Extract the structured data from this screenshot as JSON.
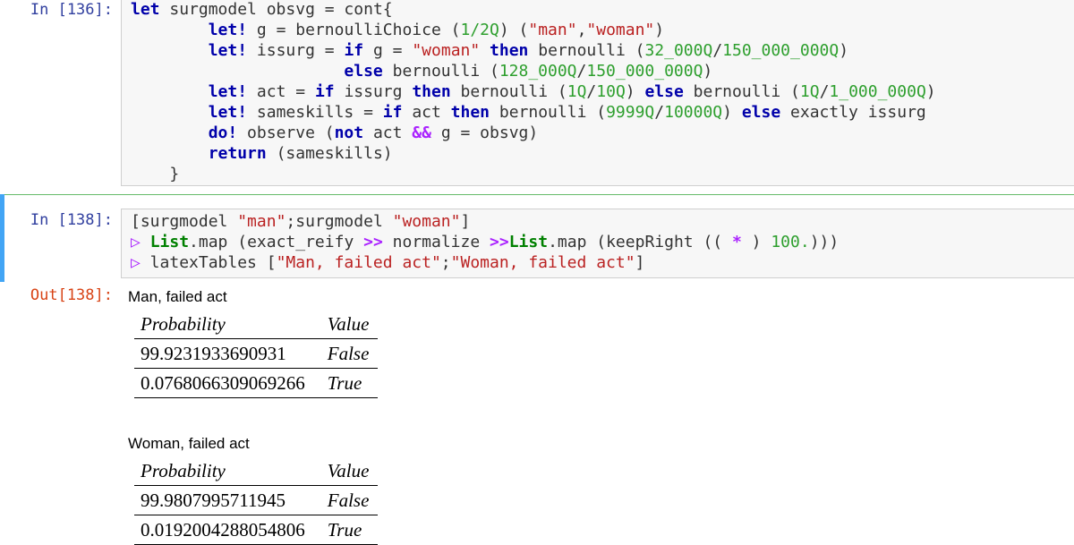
{
  "cells": [
    {
      "prompt": "In [136]:",
      "code_lines": [
        "let surgmodel obsvg = cont{",
        "        let! g = bernoulliChoice (1/2Q) (\"man\",\"woman\")",
        "        let! issurg = if g = \"woman\" then bernoulli (32_000Q/150_000_000Q)",
        "                      else bernoulli (128_000Q/150_000_000Q)",
        "        let! act = if issurg then bernoulli (1Q/10Q) else bernoulli (1Q/1_000_000Q)",
        "        let! sameskills = if act then bernoulli (9999Q/10000Q) else exactly issurg",
        "        do! observe (not act && g = obsvg)",
        "        return (sameskills)",
        "    }"
      ]
    },
    {
      "prompt": "In [138]:",
      "code_lines": [
        "[surgmodel \"man\";surgmodel \"woman\"]",
        "▷ List.map (exact_reify >> normalize >>List.map (keepRight (( * ) 100.)))",
        "▷ latexTables [\"Man, failed act\";\"Woman, failed act\"]"
      ]
    }
  ],
  "output": {
    "prompt": "Out[138]:",
    "tables": [
      {
        "title": "Man, failed act",
        "headers": [
          "Probability",
          "Value"
        ],
        "rows": [
          [
            "99.9231933690931",
            "False"
          ],
          [
            "0.0768066309069266",
            "True"
          ]
        ]
      },
      {
        "title": "Woman, failed act",
        "headers": [
          "Probability",
          "Value"
        ],
        "rows": [
          [
            "99.9807995711945",
            "False"
          ],
          [
            "0.0192004288054806",
            "True"
          ]
        ]
      }
    ]
  },
  "colors": {
    "prompt_in": "#303f9f",
    "prompt_out": "#d84315",
    "keyword": "#0000aa",
    "string": "#ba2121",
    "number": "#2e9f2e",
    "selected_cell_bar": "#42a5f5"
  }
}
